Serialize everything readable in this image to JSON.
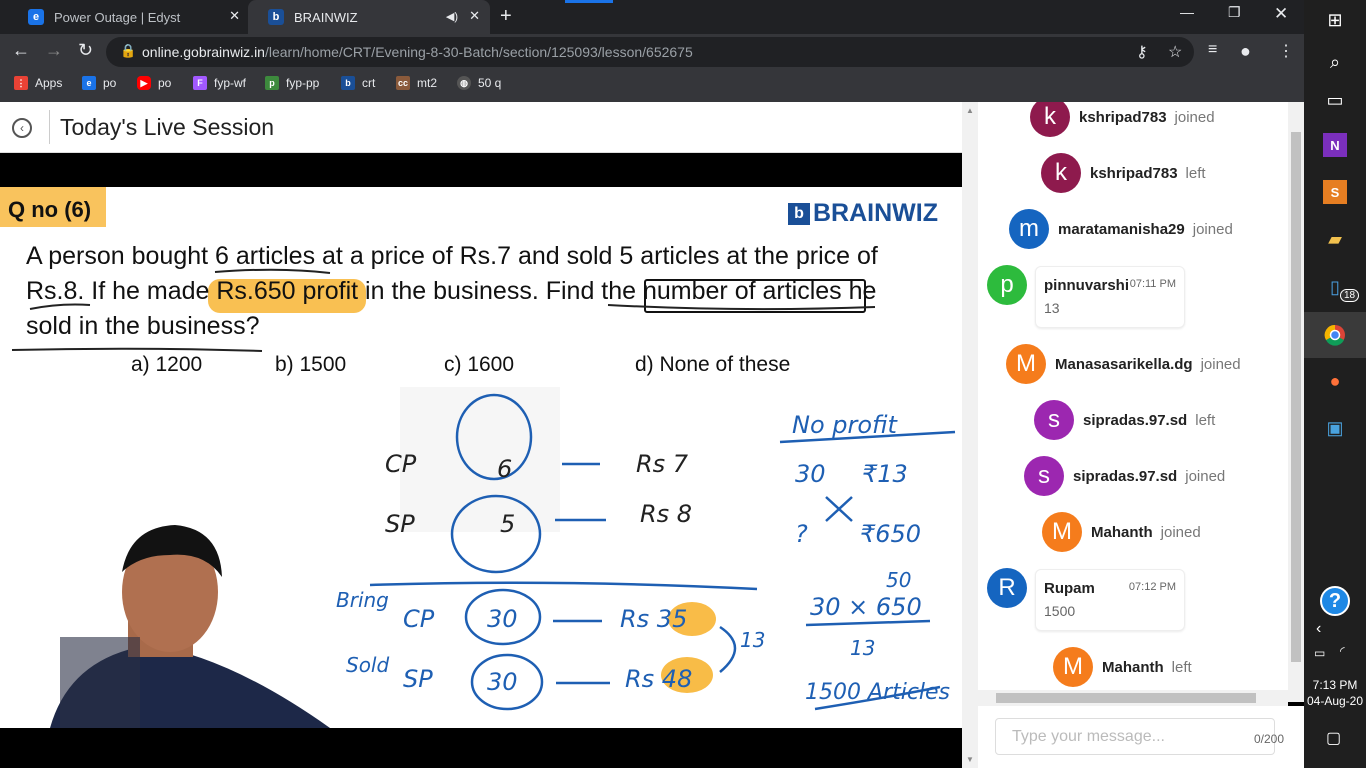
{
  "browser": {
    "tabs": [
      {
        "title": "Power Outage | Edyst",
        "favicon": "e"
      },
      {
        "title": "BRAINWIZ",
        "favicon": "b"
      }
    ],
    "url_domain": "online.gobrainwiz.in",
    "url_path": "/learn/home/CRT/Evening-8-30-Batch/section/125093/lesson/652675",
    "bookmarks": [
      {
        "label": "Apps",
        "color": "#e94235"
      },
      {
        "label": "po",
        "color": "#1a73e8"
      },
      {
        "label": "po",
        "color": "#ff0000"
      },
      {
        "label": "fyp-wf",
        "color": "#a259ff"
      },
      {
        "label": "fyp-pp",
        "color": "#3d8a3d"
      },
      {
        "label": "crt",
        "color": "#1a4f97"
      },
      {
        "label": "mt2",
        "color": "#8a5a3b"
      },
      {
        "label": "50 q",
        "color": "#555555"
      }
    ]
  },
  "session": {
    "title": "Today's Live Session"
  },
  "slide": {
    "qno": "Q no (6)",
    "brand": "BRAINWIZ",
    "question_line1": "A person bought 6 articles at a price of Rs.7 and sold  5 articles at the price of",
    "question_line2": "Rs.8. If he made Rs.650 profit in the business. Find the number of articles he",
    "question_line3": "sold in the business?",
    "options": [
      "a) 1200",
      "b)  1500",
      "c) 1600",
      "d) None of these"
    ],
    "handwriting": {
      "cp": "CP",
      "sp": "SP",
      "six": "6",
      "five": "5",
      "rs7": "Rs 7",
      "rs8": "Rs 8",
      "no_profit": "No  profit",
      "n30": "30",
      "r13": "₹13",
      "q": "?",
      "r650": "₹650",
      "bring": "Bring",
      "sold": "Sold",
      "cp2": "CP",
      "sp2": "SP",
      "c30a": "30",
      "c30b": "30",
      "rs35": "Rs 35",
      "rs48": "Rs 48",
      "t13": "13",
      "calc": "30 × 650",
      "c50": "50",
      "c13": "13",
      "answer": "1500 Articles"
    }
  },
  "chat": {
    "events": [
      {
        "user": "kshripad783",
        "action": "joined",
        "initial": "k",
        "color": "#8e1a4d"
      },
      {
        "user": "kshripad783",
        "action": "left",
        "initial": "k",
        "color": "#8e1a4d"
      },
      {
        "user": "maratamanisha29",
        "action": "joined",
        "initial": "m",
        "color": "#1565c0"
      },
      {
        "user": "pinnuvarshi",
        "time": "07:11 PM",
        "text": "13",
        "initial": "p",
        "color": "#2dbb3d"
      },
      {
        "user": "Manasasarikella.dg",
        "action": "joined",
        "initial": "M",
        "color": "#f57c1c"
      },
      {
        "user": "sipradas.97.sd",
        "action": "left",
        "initial": "s",
        "color": "#9c27b0"
      },
      {
        "user": "sipradas.97.sd",
        "action": "joined",
        "initial": "s",
        "color": "#9c27b0"
      },
      {
        "user": "Mahanth",
        "action": "joined",
        "initial": "M",
        "color": "#f57c1c"
      },
      {
        "user": "Rupam",
        "time": "07:12 PM",
        "text": "1500",
        "initial": "R",
        "color": "#1565c0"
      },
      {
        "user": "Mahanth",
        "action": "left",
        "initial": "M",
        "color": "#f57c1c"
      }
    ],
    "input_placeholder": "Type your message...",
    "counter": "0/200"
  },
  "taskbar": {
    "time": "7:13 PM",
    "date": "04-Aug-20",
    "badge": "18"
  }
}
